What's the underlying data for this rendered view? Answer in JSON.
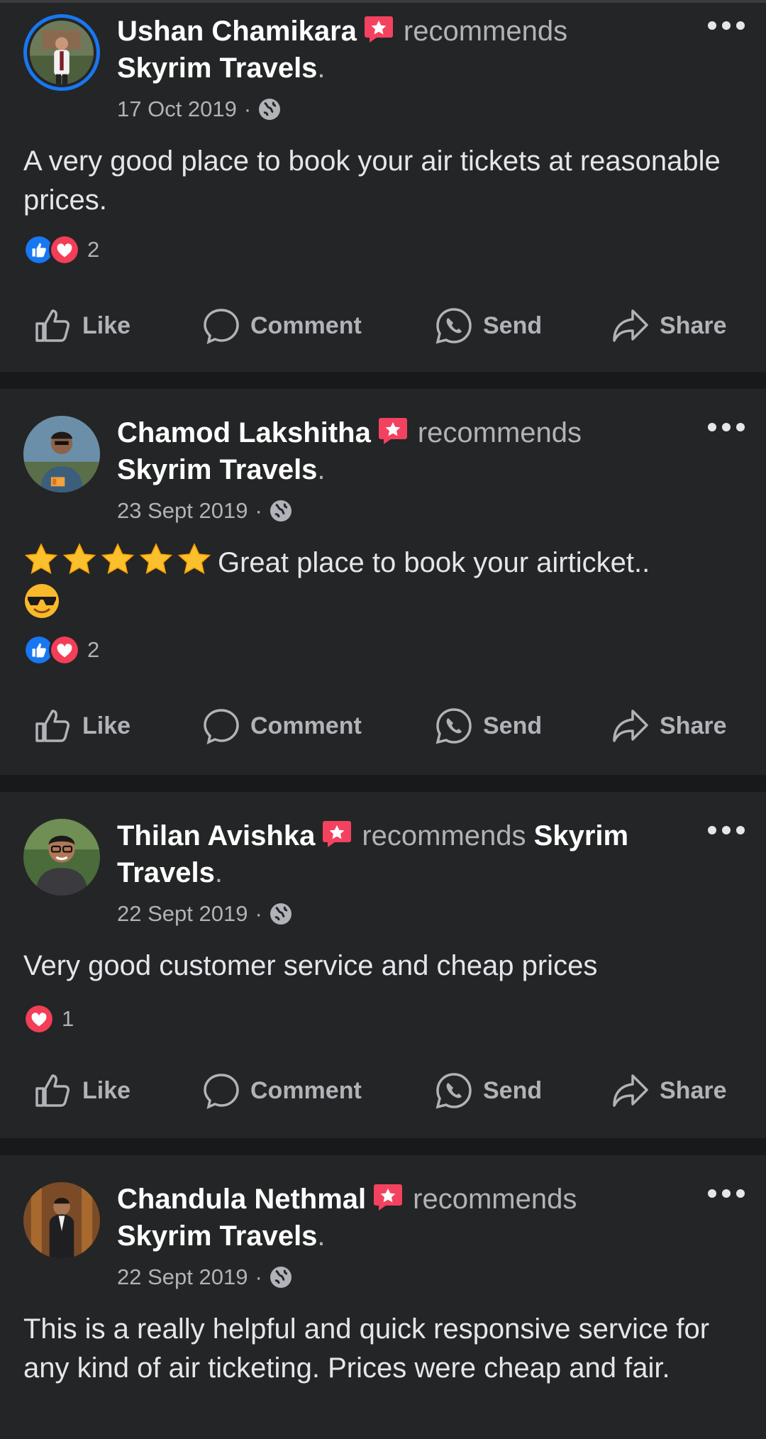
{
  "posts": [
    {
      "author": "Ushan Chamikara",
      "recommends": "recommends",
      "page": "Skyrim Travels",
      "period": ".",
      "date": "17 Oct 2019",
      "sep": "·",
      "text": "A very good place to book your air tickets at reasonable prices.",
      "reaction_count": "2",
      "reactions": [
        "like-icon",
        "love-icon"
      ]
    },
    {
      "author": "Chamod Lakshitha",
      "recommends": "recommends",
      "page": "Skyrim Travels",
      "period": ".",
      "date": "23 Sept 2019",
      "sep": "·",
      "text": "Great place to book your airticket..",
      "star_rating": 5,
      "reaction_count": "2",
      "reactions": [
        "like-icon",
        "love-icon"
      ]
    },
    {
      "author": "Thilan Avishka",
      "recommends": "recommends",
      "page": "Skyrim Travels",
      "period": ".",
      "date": "22 Sept 2019",
      "sep": "·",
      "text": "Very good customer service and cheap prices",
      "reaction_count": "1",
      "reactions": [
        "love-icon"
      ]
    },
    {
      "author": "Chandula Nethmal",
      "recommends": "recommends",
      "page": "Skyrim Travels",
      "period": ".",
      "date": "22 Sept 2019",
      "sep": "·",
      "text": "This is a really helpful and quick responsive service for any kind of air ticketing. Prices were cheap and fair."
    }
  ],
  "actions": {
    "like": "Like",
    "comment": "Comment",
    "send": "Send",
    "share": "Share"
  },
  "colors": {
    "background": "#18191a",
    "card": "#242526",
    "accent_blue": "#1877f2",
    "love_red": "#f33e58",
    "recommend_badge": "#f3425f",
    "secondary_text": "#b0b3b8"
  }
}
